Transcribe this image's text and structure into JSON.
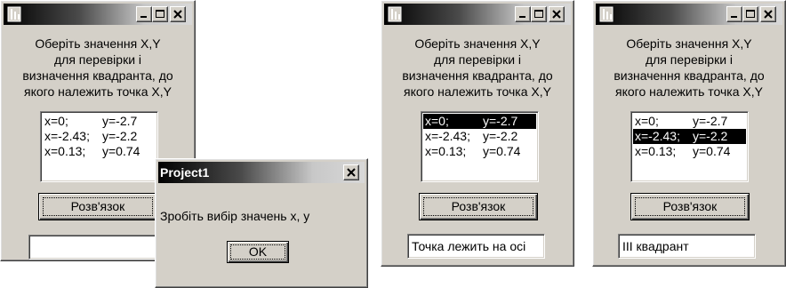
{
  "prompt_text": "Оберіть значення X,Y\nдля перевірки і\nвизначення квадранта, до\nякого належить точка X,Y",
  "list_items": [
    {
      "x": "x=0;",
      "y": "y=-2.7"
    },
    {
      "x": "x=-2.43;",
      "y": "y=-2.2"
    },
    {
      "x": "x=0.13;",
      "y": "y=0.74"
    }
  ],
  "solve_button_label": "Розв'язок",
  "windows": [
    {
      "selected_index": -1,
      "result_text": ""
    },
    {
      "selected_index": 0,
      "result_text": "Точка лежить на осі"
    },
    {
      "selected_index": 1,
      "result_text": "III квадрант"
    }
  ],
  "dialog": {
    "title": "Project1",
    "message": "Зробіть вибір значень x, y",
    "ok_label": "OK"
  },
  "icons": {
    "app": "delphi-form-icon",
    "minimize": "minimize-icon",
    "maximize": "maximize-icon",
    "close": "close-icon"
  }
}
